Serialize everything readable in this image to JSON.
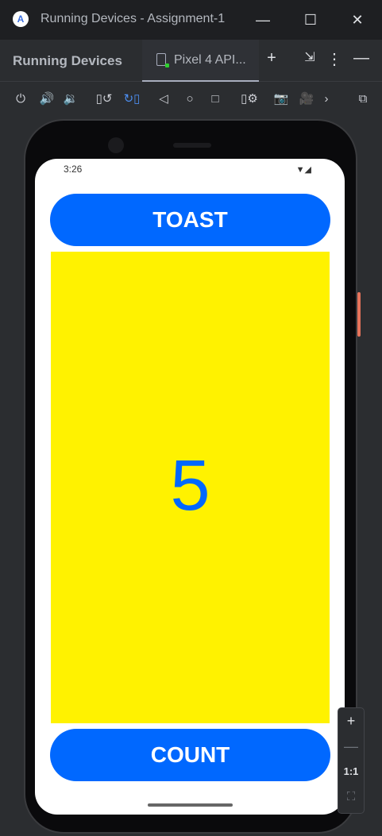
{
  "window": {
    "title": "Running Devices - Assignment-1",
    "minimize": "—",
    "maximize": "☐",
    "close": "✕",
    "logo": "A"
  },
  "tabbar": {
    "label": "Running Devices",
    "tab": "Pixel 4 API...",
    "add": "+",
    "restore": "⇲",
    "more": "⋮",
    "hide": "—"
  },
  "toolbar": [
    "power-icon",
    "volume-up-icon",
    "volume-down-icon",
    "rotate-left-icon",
    "rotate-right-icon",
    "back-icon",
    "home-icon",
    "overview-icon",
    "device-settings-icon",
    "camera-icon",
    "record-icon",
    "more-icon",
    "layout-inspector-icon"
  ],
  "toolbar_glyphs": [
    "⏻",
    "🔊",
    "🔉",
    "▯↺",
    "↻▯",
    "◁",
    "○",
    "□",
    "▯⚙",
    "📷",
    "🎥",
    "›",
    "⧉"
  ],
  "status": {
    "time": "3:26",
    "signal": "▼◢"
  },
  "app": {
    "toast": "TOAST",
    "count_value": "5",
    "count": "COUNT"
  },
  "zoom": {
    "in": "+",
    "out": "—",
    "actual": "1:1",
    "fit": "⛶"
  }
}
